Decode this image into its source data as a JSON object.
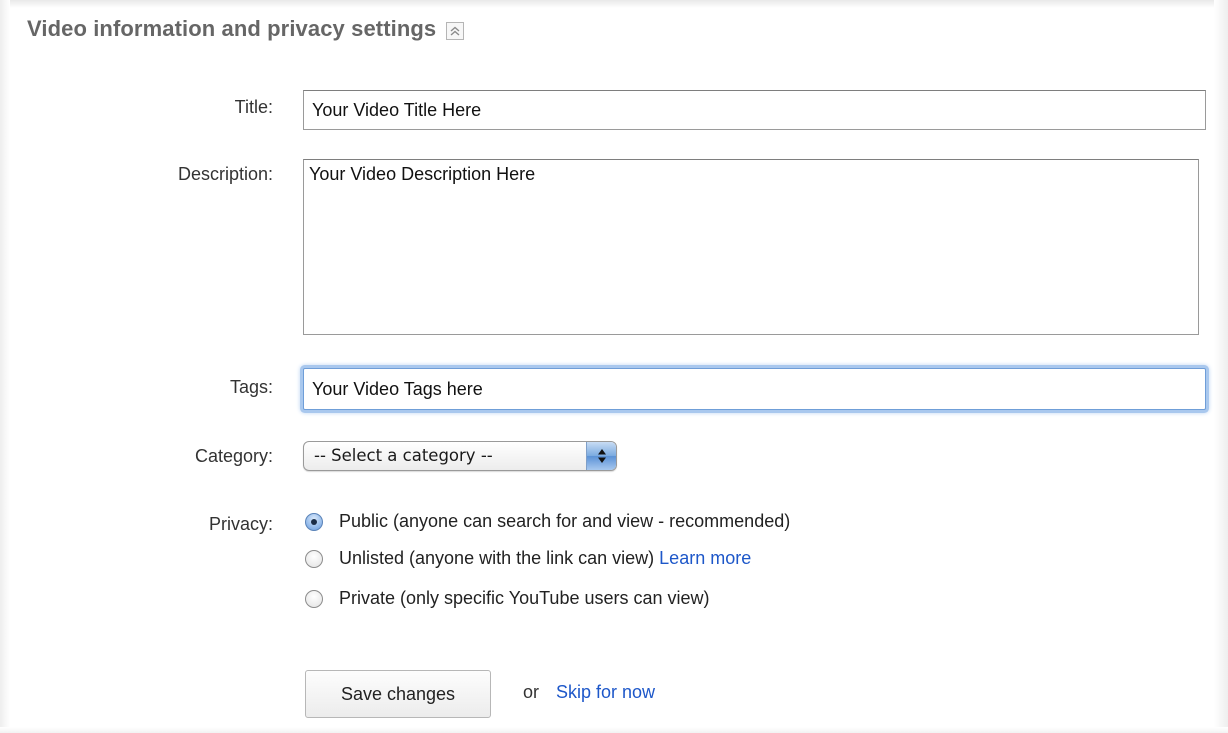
{
  "section": {
    "title": "Video information and privacy settings",
    "collapse_icon": "collapse-up-icon"
  },
  "form": {
    "title": {
      "label": "Title:",
      "value": "Your Video Title Here"
    },
    "description": {
      "label": "Description:",
      "value": "Your Video Description Here"
    },
    "tags": {
      "label": "Tags:",
      "value": "Your Video Tags here"
    },
    "category": {
      "label": "Category:",
      "selected": "-- Select a category --"
    },
    "privacy": {
      "label": "Privacy:",
      "options": [
        {
          "label": "Public (anyone can search for and view - recommended)",
          "checked": true
        },
        {
          "label": "Unlisted (anyone with the link can view)",
          "link": "Learn more",
          "checked": false
        },
        {
          "label": "Private (only specific YouTube users can view)",
          "checked": false
        }
      ]
    }
  },
  "actions": {
    "save_label": "Save changes",
    "or_text": "or",
    "skip_label": "Skip for now"
  },
  "colors": {
    "section_title": "#666666",
    "link": "#1d57c9",
    "focus_ring": "#a9c8ee"
  }
}
